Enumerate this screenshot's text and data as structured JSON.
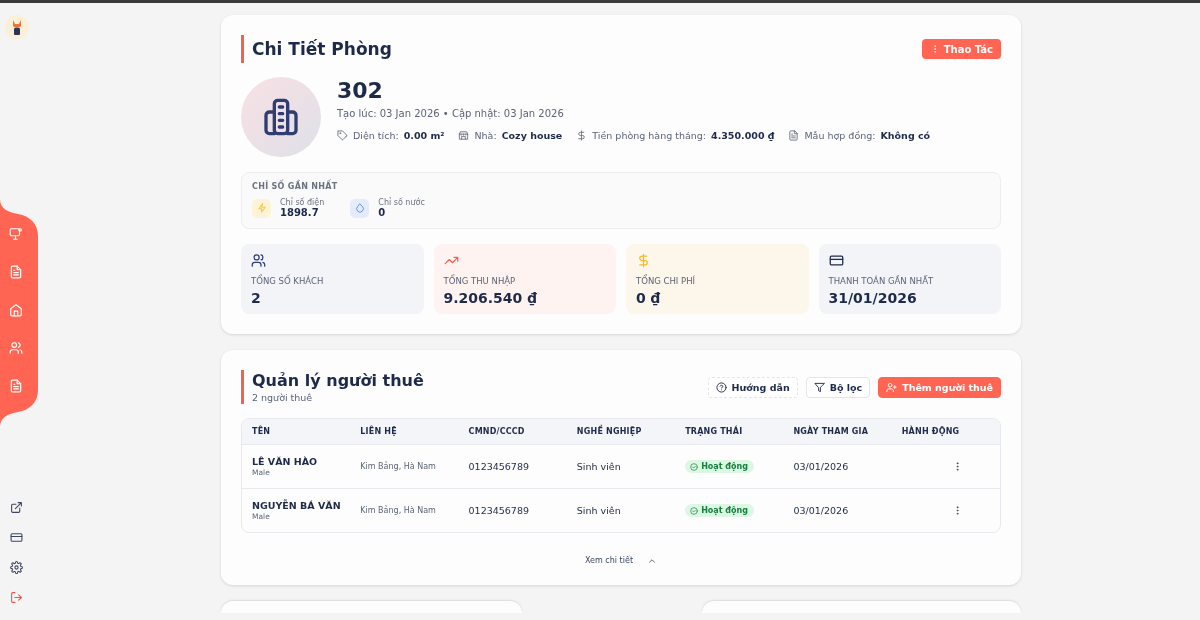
{
  "room_detail": {
    "title": "Chi Tiết Phòng",
    "action_button": "Thao Tác",
    "room_number": "302",
    "timestamps": "Tạo lúc: 03 Jan 2026 • Cập nhật: 03 Jan 2026",
    "attributes": [
      {
        "kind": "area",
        "label": "Diện tích:",
        "value": "0.00 m²"
      },
      {
        "kind": "house",
        "label": "Nhà:",
        "value": "Cozy house"
      },
      {
        "kind": "rent",
        "label": "Tiền phòng hàng tháng:",
        "value": "4.350.000 ₫"
      },
      {
        "kind": "contract",
        "label": "Mẫu hợp đồng:",
        "value": "Không có"
      }
    ],
    "latest_readings": {
      "title": "CHỈ SỐ GẦN NHẤT",
      "items": [
        {
          "kind": "electric",
          "label": "Chỉ số điện",
          "value": "1898.7"
        },
        {
          "kind": "water",
          "label": "Chỉ số nước",
          "value": "0"
        }
      ]
    },
    "stats": [
      {
        "kind": "guests",
        "label": "TỔNG SỐ KHÁCH",
        "value": "2"
      },
      {
        "kind": "income",
        "label": "TỔNG THU NHẬP",
        "value": "9.206.540 ₫"
      },
      {
        "kind": "expense",
        "label": "TỔNG CHI PHÍ",
        "value": "0 ₫"
      },
      {
        "kind": "payment",
        "label": "THANH TOÁN GẦN NHẤT",
        "value": "31/01/2026"
      }
    ]
  },
  "tenants": {
    "title": "Quản lý người thuê",
    "subtitle": "2 người thuê",
    "buttons": [
      {
        "kind": "help",
        "label": "Hướng dẫn"
      },
      {
        "kind": "filter",
        "label": "Bộ lọc"
      },
      {
        "kind": "add",
        "label": "Thêm người thuê"
      }
    ],
    "table": {
      "columns": [
        "TÊN",
        "LIÊN HỆ",
        "CMND/CCCD",
        "NGHỀ NGHIỆP",
        "TRẠNG THÁI",
        "NGÀY THAM GIA",
        "HÀNH ĐỘNG"
      ],
      "rows": [
        {
          "name": "LÊ VĂN HÀO",
          "gender": "Male",
          "contact": "Kim Bảng, Hà Nam",
          "id_number": "0123456789",
          "occupation": "Sinh viên",
          "status": "Hoạt động",
          "joined": "03/01/2026"
        },
        {
          "name": "NGUYỄN BÁ VĂN",
          "gender": "Male",
          "contact": "Kim Bảng, Hà Nam",
          "id_number": "0123456789",
          "occupation": "Sinh viên",
          "status": "Hoạt động",
          "joined": "03/01/2026"
        }
      ]
    },
    "footer_link": "Xem chi tiết"
  }
}
